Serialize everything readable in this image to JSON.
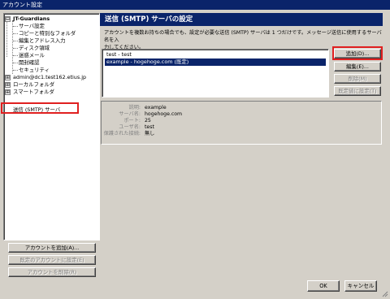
{
  "window": {
    "title": "アカウント設定"
  },
  "tree": {
    "root": "JT-Guardians",
    "children": [
      "サーバ設定",
      "コピーと特別なフォルダ",
      "編集とアドレス入力",
      "ディスク領域",
      "迷惑メール",
      "開封確認",
      "セキュリティ"
    ],
    "others": [
      "admin@dc1.test162.etius.jp",
      "ローカルフォルダ",
      "スマートフォルダ",
      "送信 (SMTP) サーバ"
    ],
    "expanders": [
      "⊟",
      "⊞",
      "⊞",
      "⊞"
    ]
  },
  "left_buttons": {
    "add_account": "アカウントを追加(A)...",
    "set_default": "既定のアカウントに設定(E)",
    "delete_account": "アカウントを削除(R)"
  },
  "main": {
    "title": "送信 (SMTP) サーバの設定",
    "description_line1": "アカウントを複数お持ちの場合でも、設定が必要な送信 (SMTP) サーバは 1 つだけです。メッセージ送信に使用するサーバ名を入",
    "description_line2": "力してください。"
  },
  "server_list": [
    "test - test",
    "example - hogehoge.com (既定)"
  ],
  "side_buttons": {
    "add": "追加(D)...",
    "edit": "編集(E)...",
    "delete": "削除(M)",
    "set_default": "既定値に設定(T)"
  },
  "details": {
    "rows": [
      {
        "label": "説明:",
        "value": "example"
      },
      {
        "label": "サーバ名:",
        "value": "hogehoge.com"
      },
      {
        "label": "ポート:",
        "value": "25"
      },
      {
        "label": "ユーザ名:",
        "value": "test"
      },
      {
        "label": "保護された接続:",
        "value": "無し"
      }
    ]
  },
  "footer": {
    "ok": "OK",
    "cancel": "キャンセル"
  },
  "colors": {
    "highlight": "#e02020",
    "selection": "#0a246a",
    "face": "#d4d0c8"
  }
}
